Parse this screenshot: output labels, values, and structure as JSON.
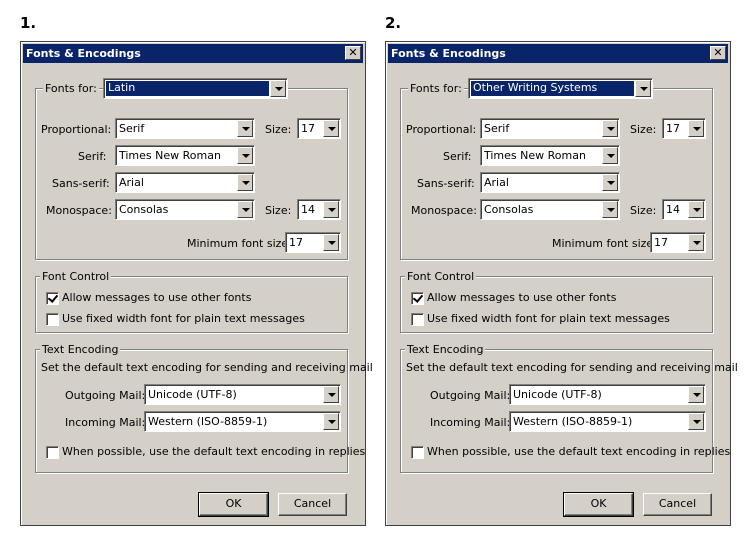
{
  "steps": [
    "1.",
    "2."
  ],
  "dialogs": [
    {
      "title": "Fonts & Encodings",
      "fonts_for": {
        "label": "Fonts for:",
        "value": "Latin"
      },
      "proportional": {
        "label": "Proportional:",
        "value": "Serif"
      },
      "size1": {
        "label": "Size:",
        "value": "17"
      },
      "serif": {
        "label": "Serif:",
        "value": "Times New Roman"
      },
      "sans_serif": {
        "label": "Sans-serif:",
        "value": "Arial"
      },
      "monospace": {
        "label": "Monospace:",
        "value": "Consolas"
      },
      "size2": {
        "label": "Size:",
        "value": "14"
      },
      "min_font": {
        "label": "Minimum font size:",
        "value": "17"
      },
      "font_control": {
        "legend": "Font Control",
        "allow": {
          "label": "Allow messages to use other fonts",
          "checked": true
        },
        "fixed": {
          "label": "Use fixed width font for plain text messages",
          "checked": false
        }
      },
      "text_encoding": {
        "legend": "Text Encoding",
        "desc": "Set the default text encoding for sending and receiving mail",
        "outgoing": {
          "label": "Outgoing Mail:",
          "value": "Unicode (UTF-8)"
        },
        "incoming": {
          "label": "Incoming Mail:",
          "value": "Western (ISO-8859-1)"
        },
        "when_possible": {
          "label": "When possible, use the default text encoding in replies",
          "checked": false
        }
      },
      "ok": "OK",
      "cancel": "Cancel"
    },
    {
      "title": "Fonts & Encodings",
      "fonts_for": {
        "label": "Fonts for:",
        "value": "Other Writing Systems"
      },
      "proportional": {
        "label": "Proportional:",
        "value": "Serif"
      },
      "size1": {
        "label": "Size:",
        "value": "17"
      },
      "serif": {
        "label": "Serif:",
        "value": "Times New Roman"
      },
      "sans_serif": {
        "label": "Sans-serif:",
        "value": "Arial"
      },
      "monospace": {
        "label": "Monospace:",
        "value": "Consolas"
      },
      "size2": {
        "label": "Size:",
        "value": "14"
      },
      "min_font": {
        "label": "Minimum font size:",
        "value": "17"
      },
      "font_control": {
        "legend": "Font Control",
        "allow": {
          "label": "Allow messages to use other fonts",
          "checked": true
        },
        "fixed": {
          "label": "Use fixed width font for plain text messages",
          "checked": false
        }
      },
      "text_encoding": {
        "legend": "Text Encoding",
        "desc": "Set the default text encoding for sending and receiving mail",
        "outgoing": {
          "label": "Outgoing Mail:",
          "value": "Unicode (UTF-8)"
        },
        "incoming": {
          "label": "Incoming Mail:",
          "value": "Western (ISO-8859-1)"
        },
        "when_possible": {
          "label": "When possible, use the default text encoding in replies",
          "checked": false
        }
      },
      "ok": "OK",
      "cancel": "Cancel"
    }
  ]
}
